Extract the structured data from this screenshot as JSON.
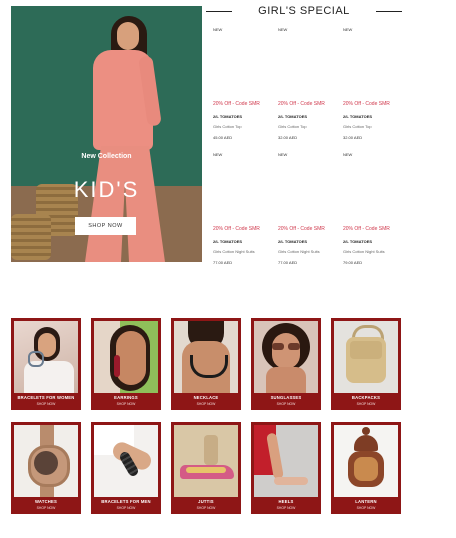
{
  "hero": {
    "subtitle": "New Collection",
    "title": "KID'S",
    "button": "SHOP NOW"
  },
  "section": {
    "title": "GIRL'S SPECIAL"
  },
  "products": [
    {
      "badge": "NEW",
      "offer": "20% Off - Code SMR",
      "brand": "2/L TOMATOES",
      "name": "Girls Cotton Top",
      "price": "45.00 AED"
    },
    {
      "badge": "NEW",
      "offer": "20% Off - Code SMR",
      "brand": "2/L TOMATOES",
      "name": "Girls Cotton Top",
      "price": "32.00 AED"
    },
    {
      "badge": "NEW",
      "offer": "20% Off - Code SMR",
      "brand": "2/L TOMATOES",
      "name": "Girls Cotton Top",
      "price": "32.00 AED"
    },
    {
      "badge": "NEW",
      "offer": "20% Off - Code SMR",
      "brand": "2/L TOMATOES",
      "name": "Girls Cotton Night Suits",
      "price": "77.00 AED"
    },
    {
      "badge": "NEW",
      "offer": "20% Off - Code SMR",
      "brand": "2/L TOMATOES",
      "name": "Girls Cotton Night Suits",
      "price": "77.00 AED"
    },
    {
      "badge": "NEW",
      "offer": "20% Off - Code SMR",
      "brand": "2/L TOMATOES",
      "name": "Girls Cotton Night Suits",
      "price": "79.00 AED"
    }
  ],
  "categories": [
    {
      "name": "BRACELETS FOR WOMEN",
      "sub": "SHOP NOW"
    },
    {
      "name": "EARRINGS",
      "sub": "SHOP NOW"
    },
    {
      "name": "NECKLACE",
      "sub": "SHOP NOW"
    },
    {
      "name": "SUNGLASSES",
      "sub": "SHOP NOW"
    },
    {
      "name": "BACKPACKS",
      "sub": "SHOP NOW"
    },
    {
      "name": "WATCHES",
      "sub": "SHOP NOW"
    },
    {
      "name": "BRACELETS FOR MEN",
      "sub": "SHOP NOW"
    },
    {
      "name": "JUTTIS",
      "sub": "SHOP NOW"
    },
    {
      "name": "HEELS",
      "sub": "SHOP NOW"
    },
    {
      "name": "LANTERN",
      "sub": "SHOP NOW"
    }
  ],
  "colors": {
    "offer": "#d0384c",
    "category_frame": "#8e1616",
    "hero_wall": "#2d6b57"
  }
}
